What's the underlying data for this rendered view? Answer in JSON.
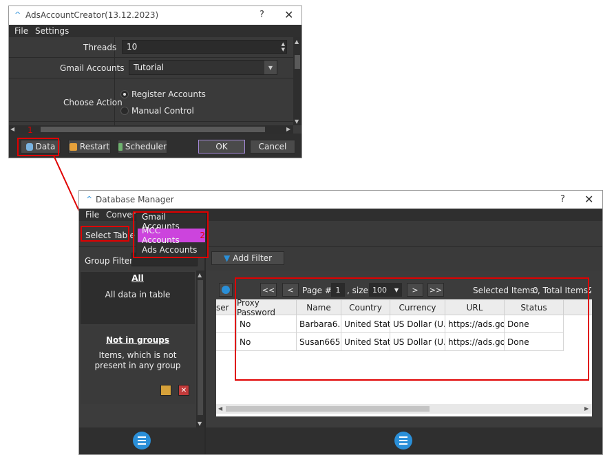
{
  "win1": {
    "title": "AdsAccountCreator(13.12.2023)",
    "menu": [
      "File",
      "Settings"
    ],
    "threads_label": "Threads",
    "threads_value": "10",
    "gmail_label": "Gmail Accounts",
    "gmail_value": "Tutorial",
    "action_label": "Choose Action",
    "action_options": [
      "Register Accounts",
      "Manual Control"
    ],
    "buttons": {
      "data": "Data",
      "restart": "Restart",
      "scheduler": "Scheduler",
      "ok": "OK",
      "cancel": "Cancel"
    },
    "annotation": "1"
  },
  "win2": {
    "title": "Database Manager",
    "menu": [
      "File",
      "Convert"
    ],
    "select_table": "Select Table",
    "table_menu": [
      "Gmail Accounts",
      "MCC Accounts",
      "Ads Accounts"
    ],
    "annotation": "2",
    "group_filter_label": "Group Filter:",
    "add_filter": "Add Filter",
    "groups": [
      {
        "title": "All",
        "desc": "All data in table"
      },
      {
        "title": "Not in groups",
        "desc": "Items, which is not present in any group"
      }
    ],
    "pager": {
      "first": "<<",
      "prev": "<",
      "page_label": "Page #",
      "page": "1",
      "size_label": ", size",
      "size": "100",
      "next": ">",
      "last": ">>",
      "selected_label": "Selected Items:",
      "selected": "0",
      "total_label": ", Total Items:",
      "total": "2"
    },
    "columns": [
      "ser",
      "Proxy Password",
      "Name",
      "Country",
      "Currency",
      "URL",
      "Status"
    ],
    "rows": [
      [
        "",
        "No",
        "Barbara6...",
        "United Stat...",
        "US Dollar (U...",
        "https://ads.go...",
        "Done"
      ],
      [
        "",
        "No",
        "Susan6653",
        "United Stat...",
        "US Dollar (U...",
        "https://ads.go...",
        "Done"
      ]
    ]
  },
  "colors": {
    "accent": "#2a8fd8",
    "highlight": "#cc44dd",
    "annotation": "#e00000"
  }
}
